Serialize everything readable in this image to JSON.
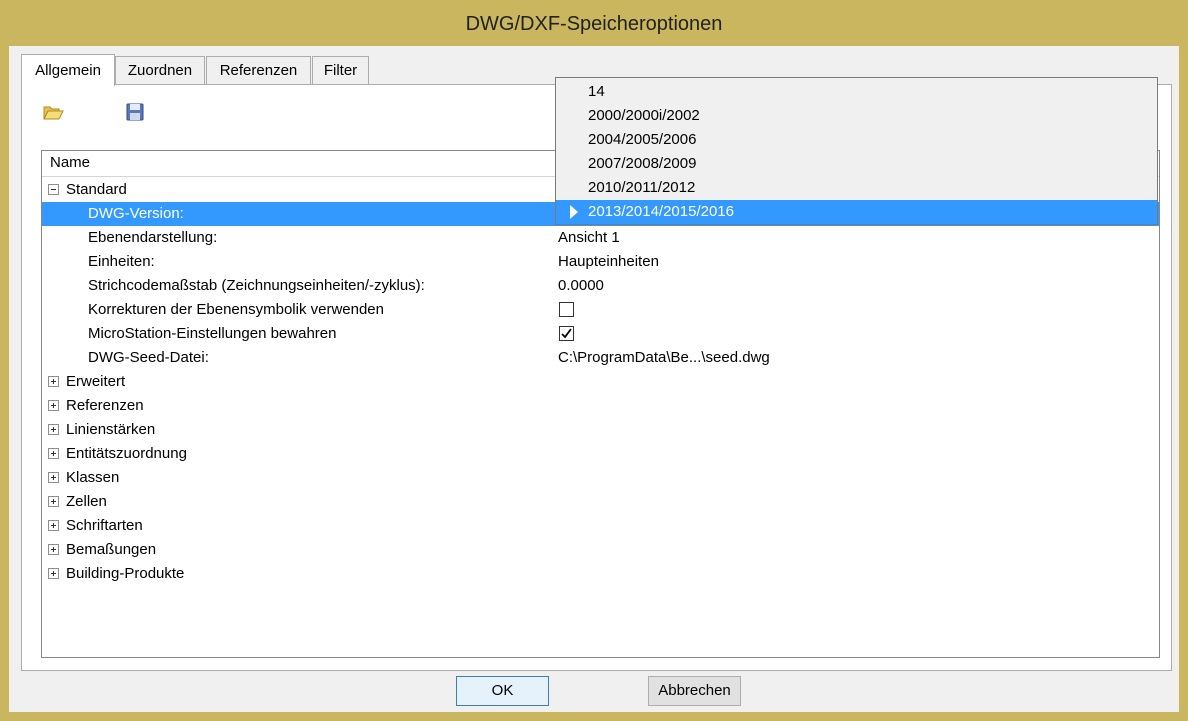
{
  "window": {
    "title": "DWG/DXF-Speicheroptionen"
  },
  "tabs": [
    "Allgemein",
    "Zuordnen",
    "Referenzen",
    "Filter"
  ],
  "toolbar": {
    "open_icon": "folder-open-icon",
    "save_icon": "floppy-disk-icon"
  },
  "grid": {
    "header": "Name",
    "rows": [
      {
        "label": "Standard",
        "value": "",
        "type": "group-expanded"
      },
      {
        "label": "DWG-Version:",
        "value": "",
        "type": "selected"
      },
      {
        "label": "Ebenendarstellung:",
        "value": "Ansicht 1"
      },
      {
        "label": "Einheiten:",
        "value": "Haupteinheiten"
      },
      {
        "label": "Strichcodemaßstab (Zeichnungseinheiten/-zyklus):",
        "value": "0.0000"
      },
      {
        "label": "Korrekturen der Ebenensymbolik verwenden",
        "checked": false
      },
      {
        "label": "MicroStation-Einstellungen bewahren",
        "checked": true
      },
      {
        "label": "DWG-Seed-Datei:",
        "value": "C:\\ProgramData\\Be...\\seed.dwg"
      },
      {
        "label": "Erweitert",
        "type": "group"
      },
      {
        "label": "Referenzen",
        "type": "group"
      },
      {
        "label": "Linienstärken",
        "type": "group"
      },
      {
        "label": "Entitätszuordnung",
        "type": "group"
      },
      {
        "label": "Klassen",
        "type": "group"
      },
      {
        "label": "Zellen",
        "type": "group"
      },
      {
        "label": "Schriftarten",
        "type": "group"
      },
      {
        "label": "Bemaßungen",
        "type": "group"
      },
      {
        "label": "Building-Produkte",
        "type": "group"
      }
    ]
  },
  "dropdown": {
    "options": [
      "14",
      "2000/2000i/2002",
      "2004/2005/2006",
      "2007/2008/2009",
      "2010/2011/2012",
      "2013/2014/2015/2016"
    ],
    "selected": "2013/2014/2015/2016"
  },
  "buttons": {
    "ok": "OK",
    "cancel": "Abbrechen"
  },
  "colors": {
    "selection": "#3399ff",
    "frame": "#c9b65f"
  }
}
